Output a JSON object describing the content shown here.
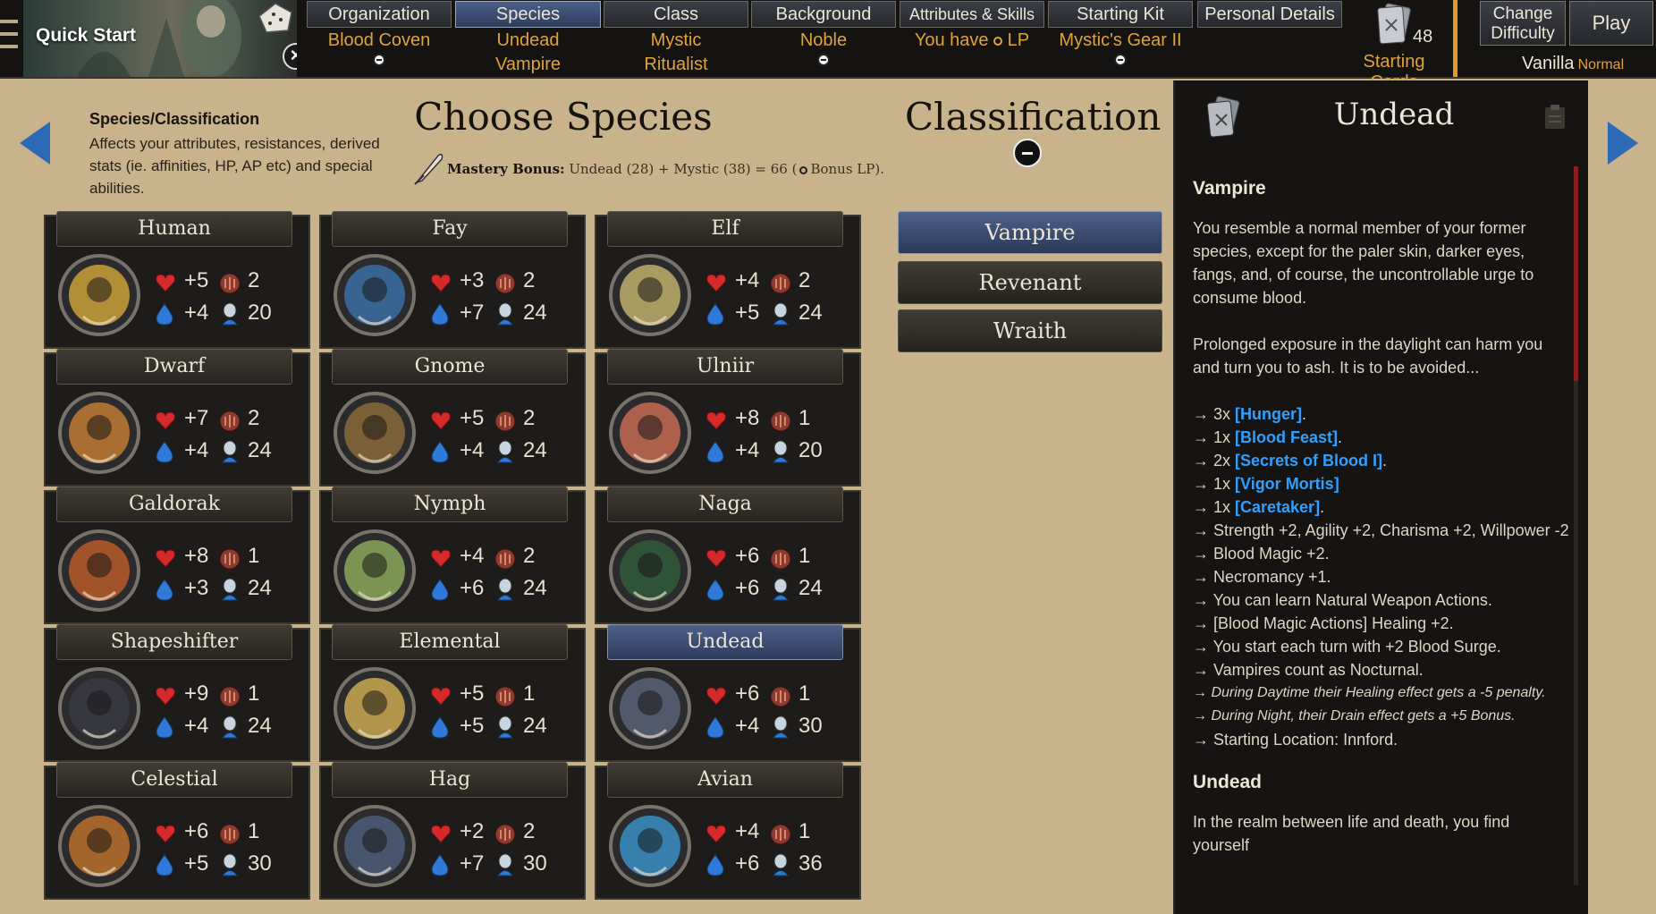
{
  "topbar": {
    "quick_start": "Quick Start",
    "tabs": [
      {
        "label": "Organization",
        "value": "Blood Coven",
        "value2": ""
      },
      {
        "label": "Species",
        "value": "Undead",
        "value2": "Vampire"
      },
      {
        "label": "Class",
        "value": "Mystic",
        "value2": "Ritualist"
      },
      {
        "label": "Background",
        "value": "Noble",
        "value2": ""
      },
      {
        "label": "Attributes & Skills",
        "value": "You have",
        "value_suffix": "LP"
      },
      {
        "label": "Starting Kit",
        "value": "Mystic's Gear II",
        "value2": ""
      },
      {
        "label": "Personal Details",
        "value": "",
        "value2": ""
      }
    ],
    "starting_cards_count": "48",
    "starting_cards_label": "Starting Cards",
    "change_difficulty": "Change Difficulty",
    "change_difficulty_l1": "Change",
    "change_difficulty_l2": "Difficulty",
    "play": "Play",
    "difficulty": "Vanilla",
    "difficulty_sub": "Normal"
  },
  "left": {
    "info_title": "Species/Classification",
    "info_desc": "Affects your attributes, resistances, derived stats (ie. affinities, HP, AP etc) and special abilities.",
    "choose_title": "Choose Species",
    "mastery_label": "Mastery Bonus:",
    "mastery_text": "Undead (28) + Mystic (38) = 66 (",
    "mastery_suffix": "Bonus LP).",
    "classification_title": "Classification"
  },
  "species": [
    {
      "name": "Human",
      "hp": "+5",
      "ap": "+4",
      "armor": "2",
      "move": "20",
      "color": "#c9a13a"
    },
    {
      "name": "Fay",
      "hp": "+3",
      "ap": "+7",
      "armor": "2",
      "move": "24",
      "color": "#3b6fa3"
    },
    {
      "name": "Elf",
      "hp": "+4",
      "ap": "+5",
      "armor": "2",
      "move": "24",
      "color": "#bfae6c"
    },
    {
      "name": "Dwarf",
      "hp": "+7",
      "ap": "+4",
      "armor": "2",
      "move": "24",
      "color": "#c07a32"
    },
    {
      "name": "Gnome",
      "hp": "+5",
      "ap": "+4",
      "armor": "2",
      "move": "24",
      "color": "#8a6a3a"
    },
    {
      "name": "Ulniir",
      "hp": "+8",
      "ap": "+4",
      "armor": "1",
      "move": "20",
      "color": "#c46a52"
    },
    {
      "name": "Galdorak",
      "hp": "+8",
      "ap": "+3",
      "armor": "1",
      "move": "24",
      "color": "#b85a2a"
    },
    {
      "name": "Nymph",
      "hp": "+4",
      "ap": "+6",
      "armor": "2",
      "move": "24",
      "color": "#8aa65a"
    },
    {
      "name": "Naga",
      "hp": "+6",
      "ap": "+6",
      "armor": "1",
      "move": "24",
      "color": "#2f5a3a"
    },
    {
      "name": "Shapeshifter",
      "hp": "+9",
      "ap": "+4",
      "armor": "1",
      "move": "24",
      "color": "#3a3a44"
    },
    {
      "name": "Elemental",
      "hp": "+5",
      "ap": "+5",
      "armor": "1",
      "move": "24",
      "color": "#c8a850"
    },
    {
      "name": "Undead",
      "hp": "+6",
      "ap": "+4",
      "armor": "1",
      "move": "30",
      "color": "#5a6278"
    },
    {
      "name": "Celestial",
      "hp": "+6",
      "ap": "+5",
      "armor": "1",
      "move": "30",
      "color": "#b8702c"
    },
    {
      "name": "Hag",
      "hp": "+2",
      "ap": "+7",
      "armor": "2",
      "move": "30",
      "color": "#4c5e7a"
    },
    {
      "name": "Avian",
      "hp": "+4",
      "ap": "+6",
      "armor": "1",
      "move": "36",
      "color": "#3a8ec4"
    }
  ],
  "classifications": [
    "Vampire",
    "Revenant",
    "Wraith"
  ],
  "detail": {
    "title": "Undead",
    "heading": "Vampire",
    "p1": "You resemble a normal member of your former species, except for the paler skin, darker eyes, fangs, and, of course, the uncontrollable urge to consume blood.",
    "p2": "Prolonged exposure in the daylight can harm you and turn you to ash. It is to be avoided...",
    "kw_items": [
      {
        "prefix": "→ 3x ",
        "kw": "[Hunger]"
      },
      {
        "prefix": "→ 1x ",
        "kw": "[Blood Feast]"
      },
      {
        "prefix": "→ 2x ",
        "kw": "[Secrets of Blood I]"
      },
      {
        "prefix": "→ 1x ",
        "kw": "[Vigor Mortis]"
      },
      {
        "prefix": "→ 1x ",
        "kw": "[Caretaker]"
      }
    ],
    "items": [
      "→ Strength +2, Agility +2, Charisma +2, Willpower -2.",
      "→ Blood Magic +2.",
      "→ Necromancy +1.",
      "→ You can learn Natural Weapon Actions.",
      "→ [Blood Magic Actions] Healing +2.",
      "→ You start each turn with +2 Blood Surge.",
      "→ Vampires count as Nocturnal."
    ],
    "italic_items": [
      "→ During Daytime their Healing effect gets a -5 penalty.",
      "→ During Night, their Drain effect gets a +5 Bonus."
    ],
    "last_item": "→ Starting Location: Innford.",
    "heading2": "Undead",
    "p3": "In the realm between life and death, you find yourself"
  },
  "colors": {
    "accent_blue": "#2d6ab6",
    "value_orange": "#e0a33a",
    "keyword_blue": "#2fa0ff"
  }
}
